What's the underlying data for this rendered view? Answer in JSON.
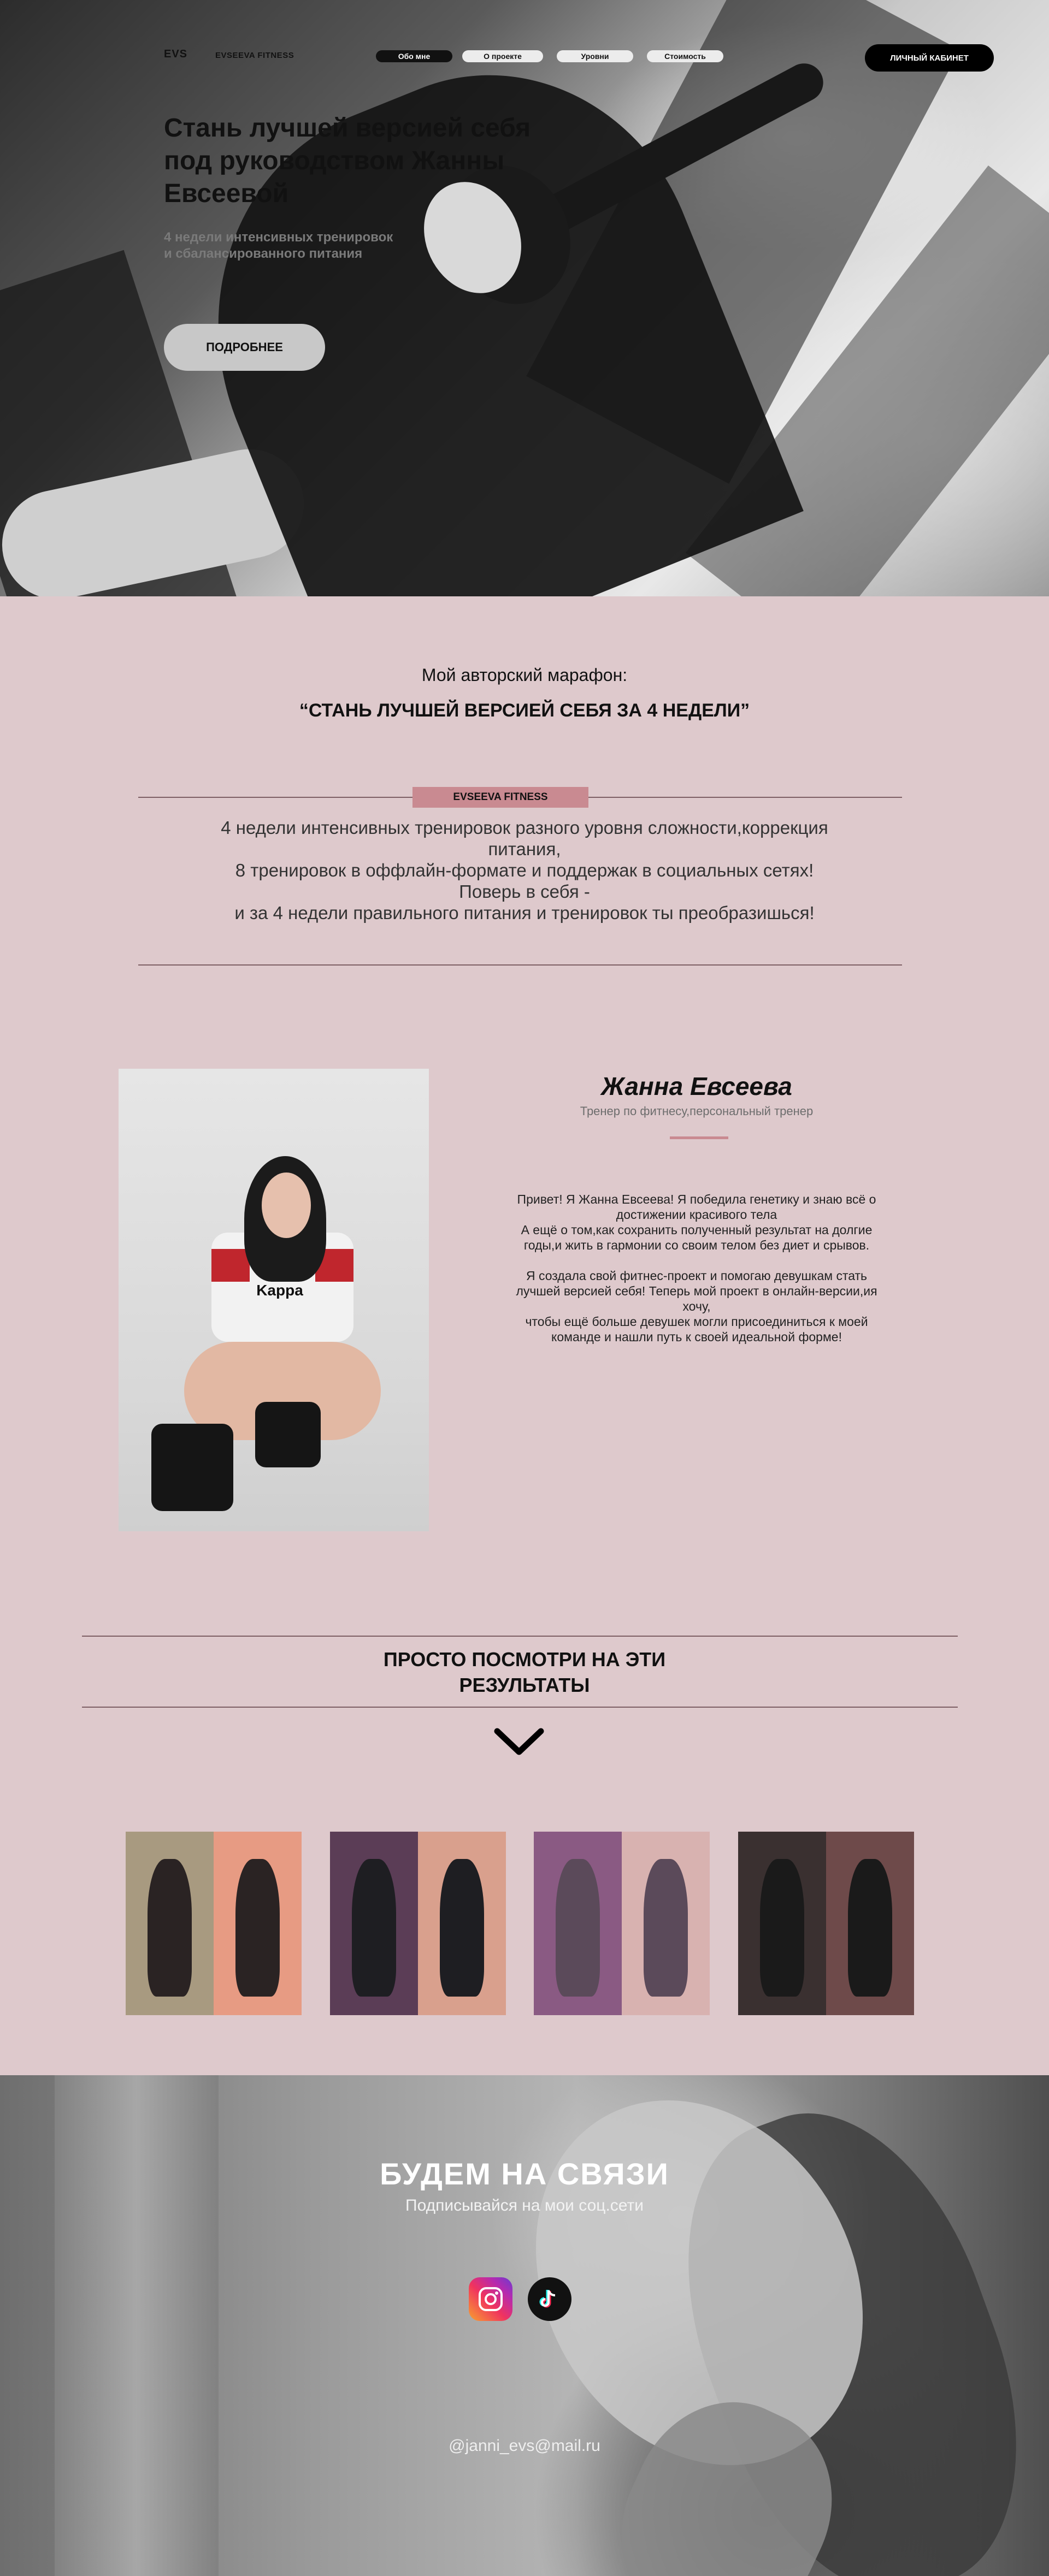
{
  "header": {
    "logo": "EVS",
    "brand": "EVSEEVA FITNESS",
    "nav": [
      {
        "label": "Обо мне",
        "active": true
      },
      {
        "label": "О проекте",
        "active": false
      },
      {
        "label": "Уровни",
        "active": false
      },
      {
        "label": "Стоимость",
        "active": false
      }
    ],
    "cabinet_label": "ЛИЧНЫЙ КАБИНЕТ"
  },
  "hero": {
    "title": "Стань лучшей версией себя под руководством Жанны Евсеевой",
    "subtitle": "4 недели интенсивных тренировок и сбалансированного питания",
    "more_label": "ПОДРОБНЕЕ"
  },
  "marathon": {
    "pre": "Мой авторский марафон:",
    "title": "“СТАНЬ ЛУЧШЕЙ ВЕРСИЕЙ СЕБЯ ЗА 4 НЕДЕЛИ”",
    "tag": "EVSEEVA FITNESS",
    "description": "4 недели интенсивных тренировок разного уровня сложности,коррекция питания,\n8 тренировок в оффлайн-формате и поддержак в социальных сетях! Поверь в себя -\nи за 4 недели правильного питания и тренировок ты преобразишься!"
  },
  "about": {
    "photo_text": "Kappa",
    "name": "Жанна Евсеева",
    "role": "Тренер по фитнесу,персональный тренер",
    "bio1": "Привет! Я Жанна Евсеева! Я победила генетику и знаю всё о достижении красивого тела\nА ещё о том,как сохранить полученный результат на долгие годы,и жить в гармонии со своим телом без диет и срывов.",
    "bio2": "Я создала свой фитнес-проект и помогаю девушкам стать лучшей версией себя! Теперь мой проект в онлайн-версии,ия хочу,\nчтобы ещё больше девушек могли присоединиться к моей команде и нашли путь к своей идеальной форме!"
  },
  "results": {
    "title": "ПРОСТО ПОСМОТРИ НА ЭТИ РЕЗУЛЬТАТЫ",
    "chevron_icon": "chevron-down-icon",
    "photos": [
      {
        "left_bg": "#a89a80",
        "right_bg": "#e79b83",
        "fig": "#2a2323"
      },
      {
        "left_bg": "#5b3d56",
        "right_bg": "#d9a08d",
        "fig": "#1e1e22"
      },
      {
        "left_bg": "#8a5a83",
        "right_bg": "#d8b2b0",
        "fig": "#5b4a5a"
      },
      {
        "left_bg": "#3a3030",
        "right_bg": "#6e4a4a",
        "fig": "#1a1a1a"
      }
    ]
  },
  "footer": {
    "title": "БУДЕМ НА СВЯЗИ",
    "subtitle": "Подписывайся на мои соц.сети",
    "social": [
      "instagram-icon",
      "tiktok-icon"
    ],
    "email": "@janni_evs@mail.ru"
  },
  "colors": {
    "page_bg": "#dec9cc",
    "accent": "#c98a91",
    "divider": "#7d5f64"
  }
}
